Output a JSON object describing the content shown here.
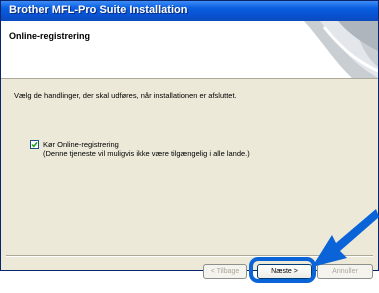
{
  "window": {
    "title": "Brother MFL-Pro Suite Installation"
  },
  "header": {
    "heading": "Online-registrering"
  },
  "main": {
    "instruction": "Vælg de handlinger, der skal udføres, når installationen er afsluttet.",
    "option": {
      "label": "Kør Online-registrering",
      "note": "(Denne tjeneste vil muligvis ikke være tilgængelig i alle lande.)",
      "checked": true
    }
  },
  "buttons": {
    "back": "< Tilbage",
    "next": "Næste >",
    "cancel": "Annuller"
  },
  "colors": {
    "title_bar": "#0852d2",
    "dialog_bg": "#ece9d8",
    "highlight": "#0a64d8"
  },
  "icons": [
    "check-icon",
    "brother-logo",
    "pointer-arrow-icon"
  ]
}
